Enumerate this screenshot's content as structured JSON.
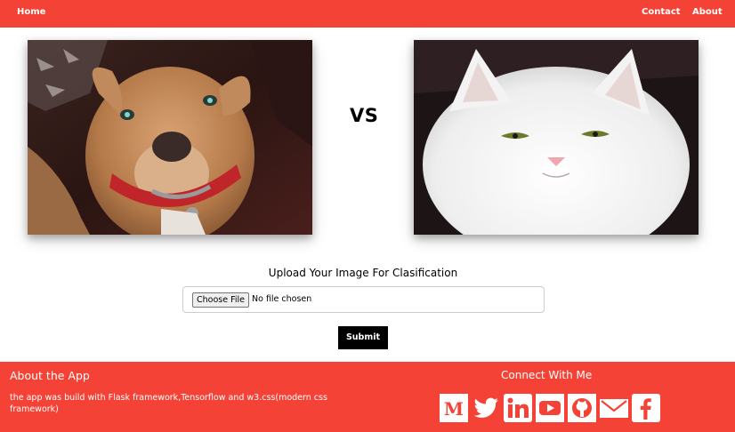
{
  "nav": {
    "home": "Home",
    "contact": "Contact",
    "about": "About"
  },
  "comparison": {
    "vs_label": "VS",
    "left_image": "dog-photo",
    "right_image": "cat-photo"
  },
  "upload": {
    "title": "Upload Your Image For Clasification",
    "choose_label": "Choose File",
    "status": "No file chosen",
    "submit_label": "Submit"
  },
  "footer": {
    "about_title": "About the App",
    "about_text": "the app was build with Flask framework,Tensorflow and w3.css(modern css framework)",
    "connect_title": "Connect With Me",
    "socials": [
      "medium-icon",
      "twitter-icon",
      "linkedin-icon",
      "youtube-icon",
      "github-icon",
      "email-icon",
      "facebook-icon"
    ]
  },
  "colors": {
    "accent": "#f44336",
    "submit_bg": "#000000"
  }
}
